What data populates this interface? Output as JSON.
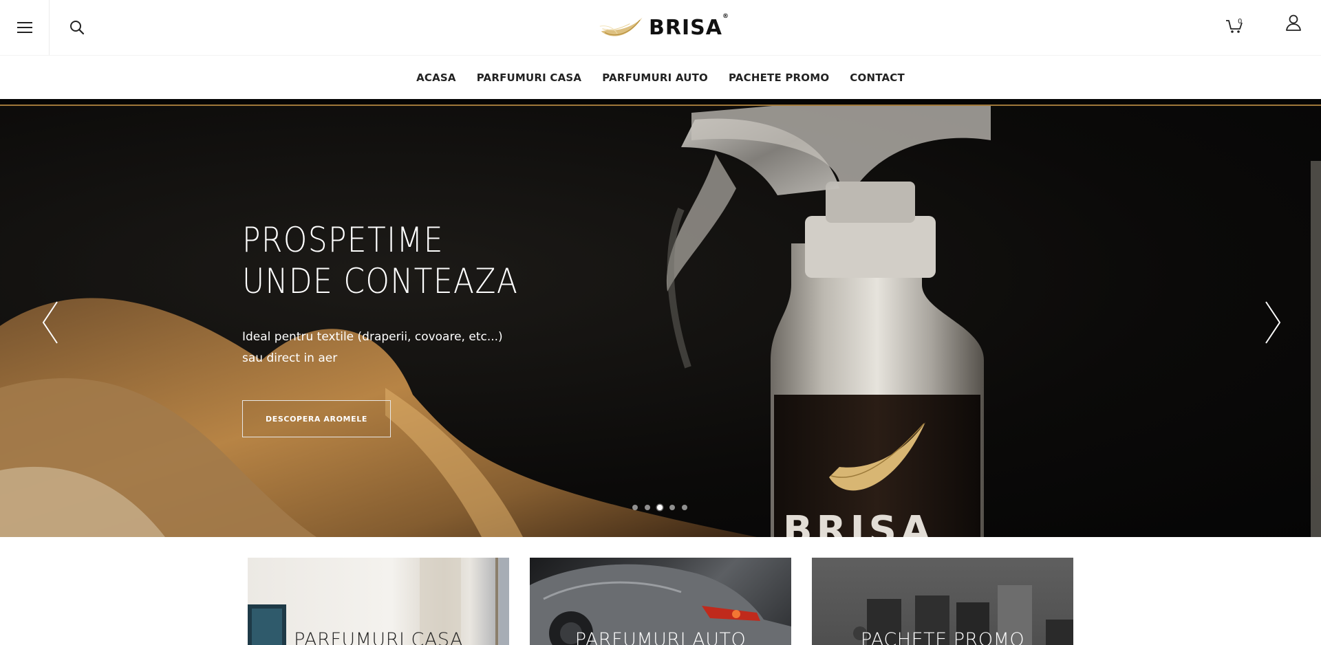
{
  "header": {
    "brand": "BRISA",
    "brand_mark": "®",
    "cart_count": "0",
    "icons": {
      "menu": "hamburger-menu-icon",
      "search": "search-icon",
      "cart": "cart-icon",
      "account": "user-account-icon"
    }
  },
  "nav": {
    "items": [
      {
        "label": "ACASA"
      },
      {
        "label": "PARFUMURI CASA"
      },
      {
        "label": "PARFUMURI AUTO"
      },
      {
        "label": "PACHETE PROMO"
      },
      {
        "label": "CONTACT"
      }
    ]
  },
  "hero": {
    "title_line1": "PROSPETIME",
    "title_line2": "UNDE CONTEAZA",
    "text_line1": "Ideal pentru textile (draperii, covoare, etc...)",
    "text_line2": "sau direct in aer",
    "cta": "DESCOPERA AROMELE",
    "slide_count": 5,
    "active_slide": 3,
    "bottle_brand": "BRISA",
    "colors": {
      "accent_gold": "#a0783a",
      "background": "#0b0a09"
    }
  },
  "categories": [
    {
      "label": "PARFUMURI CASA"
    },
    {
      "label": "PARFUMURI AUTO"
    },
    {
      "label": "PACHETE PROMO"
    }
  ]
}
